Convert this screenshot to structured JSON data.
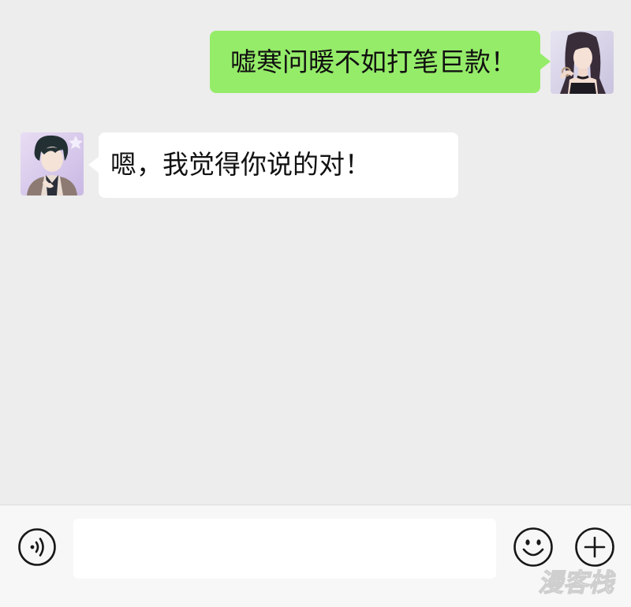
{
  "chat": {
    "messages": [
      {
        "side": "right",
        "sender": "female-user",
        "text": "嘘寒问暖不如打笔巨款！"
      },
      {
        "side": "left",
        "sender": "male-user",
        "text": "嗯，我觉得你说的对！"
      }
    ]
  },
  "input_bar": {
    "text_value": "",
    "placeholder": "",
    "icons": [
      "voice-icon",
      "emoji-icon",
      "plus-icon"
    ]
  },
  "watermark": {
    "text": "漫客栈"
  },
  "colors": {
    "background": "#ededed",
    "sent_bubble": "#95ec69",
    "received_bubble": "#ffffff",
    "input_bar": "#f7f7f7",
    "icon_stroke": "#181818"
  }
}
